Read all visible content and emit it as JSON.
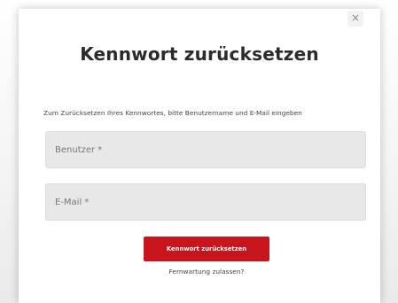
{
  "dialog": {
    "close_label": "×",
    "title": "Kennwort zurücksetzen",
    "description": "Zum Zurücksetzen Ihres Kennwortes, bitte Benutzername und E-Mail eingeben",
    "user_field": {
      "value": "",
      "placeholder": "Benutzer *"
    },
    "email_field": {
      "value": "",
      "placeholder": "E-Mail *"
    },
    "submit_label": "Kennwort zurücksetzen",
    "remote_link": "Fernwartung zulassen?"
  },
  "colors": {
    "accent": "#c8141d",
    "field_background": "#e8e8e8",
    "title_text": "#2b2b2b"
  }
}
